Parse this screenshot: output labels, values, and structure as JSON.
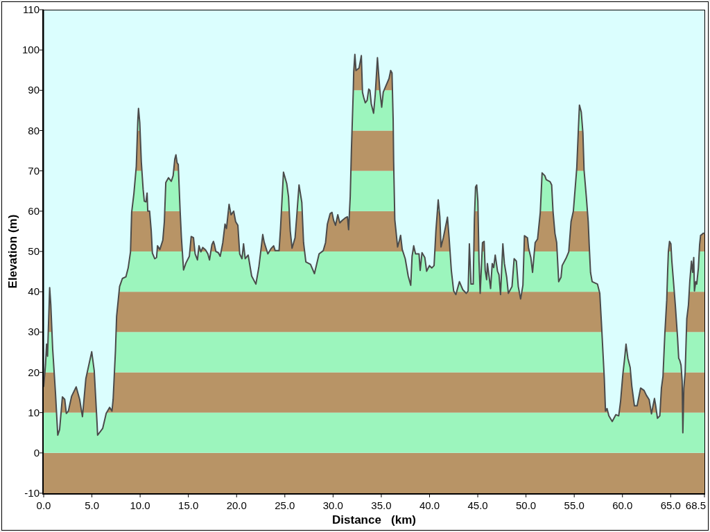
{
  "elevation_profile": {
    "chart_data": {
      "type": "area",
      "xlabel": "Distance   (km)",
      "ylabel": "Elevation (m)",
      "x": [
        0,
        0.19,
        0.3,
        0.4,
        0.5,
        0.62,
        0.74,
        0.93,
        1.22,
        1.46,
        1.65,
        1.94,
        2.18,
        2.35,
        2.56,
        2.9,
        3.37,
        3.73,
        4.02,
        4.37,
        4.98,
        5.24,
        5.53,
        5.59,
        6.12,
        6.48,
        6.84,
        7.08,
        7.2,
        7.44,
        7.56,
        7.87,
        8.16,
        8.52,
        8.76,
        9.0,
        9.12,
        9.35,
        9.6,
        9.76,
        9.83,
        9.96,
        10.12,
        10.31,
        10.43,
        10.6,
        10.72,
        10.79,
        10.98,
        11.15,
        11.27,
        11.51,
        11.7,
        11.8,
        12.04,
        12.35,
        12.51,
        12.66,
        12.94,
        13.23,
        13.42,
        13.59,
        13.71,
        13.83,
        13.95,
        14.14,
        14.28,
        14.5,
        14.74,
        15.1,
        15.29,
        15.53,
        15.7,
        15.94,
        16.1,
        16.3,
        16.49,
        16.78,
        17.02,
        17.19,
        17.44,
        17.6,
        17.7,
        17.85,
        18.1,
        18.3,
        18.57,
        18.8,
        18.95,
        19.22,
        19.42,
        19.7,
        19.9,
        20.13,
        20.32,
        20.56,
        20.72,
        20.89,
        21.2,
        21.56,
        22.0,
        22.3,
        22.71,
        22.86,
        23.24,
        23.6,
        23.84,
        24.0,
        24.4,
        24.55,
        24.86,
        25.2,
        25.38,
        25.56,
        25.75,
        26.06,
        26.23,
        26.47,
        26.76,
        26.94,
        27.18,
        27.66,
        28.07,
        28.55,
        28.98,
        29.22,
        29.41,
        29.7,
        29.89,
        30.06,
        30.25,
        30.49,
        30.7,
        30.94,
        31.25,
        31.49,
        31.61,
        31.78,
        31.9,
        32.09,
        32.14,
        32.26,
        32.38,
        32.69,
        32.93,
        33.05,
        33.17,
        33.34,
        33.53,
        33.7,
        33.82,
        33.96,
        34.2,
        34.37,
        34.6,
        34.85,
        35.04,
        35.2,
        35.44,
        35.8,
        35.97,
        36.11,
        36.23,
        36.28,
        36.4,
        36.52,
        36.69,
        36.88,
        37.0,
        37.17,
        37.48,
        37.79,
        38.05,
        38.19,
        38.36,
        38.55,
        38.91,
        39.03,
        39.22,
        39.51,
        39.7,
        39.99,
        40.23,
        40.47,
        40.66,
        40.9,
        41.07,
        41.19,
        41.43,
        41.86,
        42.03,
        42.26,
        42.5,
        42.73,
        43.1,
        43.45,
        43.81,
        44.0,
        44.13,
        44.3,
        44.53,
        44.65,
        44.77,
        44.89,
        45.01,
        45.13,
        45.25,
        45.49,
        45.66,
        45.77,
        45.92,
        46.0,
        46.15,
        46.33,
        46.5,
        46.65,
        46.81,
        47.05,
        47.2,
        47.36,
        47.6,
        47.76,
        48.0,
        48.17,
        48.55,
        48.77,
        49.0,
        49.2,
        49.44,
        49.68,
        49.84,
        50.15,
        50.27,
        50.5,
        50.68,
        50.95,
        51.2,
        51.48,
        51.67,
        51.95,
        52.1,
        52.5,
        52.66,
        52.8,
        53.0,
        53.18,
        53.39,
        53.63,
        53.75,
        54.19,
        54.43,
        54.67,
        54.91,
        55.26,
        55.43,
        55.54,
        55.73,
        55.9,
        56.02,
        56.26,
        56.45,
        56.55,
        56.69,
        56.86,
        57.41,
        57.65,
        57.81,
        57.97,
        58.12,
        58.24,
        58.4,
        58.59,
        58.94,
        59.32,
        59.61,
        59.8,
        60.04,
        60.2,
        60.37,
        60.56,
        60.8,
        60.97,
        61.24,
        61.52,
        61.88,
        62.24,
        62.48,
        62.77,
        63.01,
        63.15,
        63.32,
        63.44,
        63.63,
        63.87,
        64.04,
        64.2,
        64.4,
        64.59,
        64.69,
        64.76,
        64.88,
        65.02,
        65.12,
        65.24,
        65.48,
        65.71,
        65.83,
        65.95,
        66.07,
        66.19,
        66.26,
        66.36,
        66.5,
        66.67,
        66.84,
        66.98,
        67.15,
        67.27,
        67.39,
        67.46,
        67.6,
        67.7,
        67.87,
        68.0,
        68.1,
        68.23,
        68.35,
        68.5
      ],
      "series": [
        {
          "color": "#4a4a4a",
          "values": [
            16.5,
            21.9,
            27,
            24,
            32,
            41,
            36.7,
            25.9,
            15,
            4.4,
            5.8,
            13.9,
            13.3,
            9.8,
            10.4,
            14.1,
            16.4,
            13.3,
            9,
            18.4,
            25.1,
            20.4,
            7.5,
            4.4,
            6.1,
            9.8,
            11.3,
            10.4,
            13.3,
            25.3,
            33.9,
            41.3,
            43.3,
            43.7,
            45.9,
            49.9,
            59.7,
            64.3,
            71.1,
            82.6,
            85.5,
            82,
            72.3,
            65.4,
            62.5,
            62.3,
            64.5,
            60,
            60,
            55.1,
            49.6,
            48.2,
            48.5,
            51.4,
            50.5,
            52.8,
            57.4,
            67.1,
            68.3,
            67.4,
            68.8,
            72.9,
            74,
            72,
            71.6,
            60.3,
            53.4,
            45.4,
            47.1,
            48.8,
            53.7,
            53.4,
            49.4,
            47.9,
            51.4,
            49.9,
            51,
            50.4,
            49.4,
            47.9,
            51.7,
            52.5,
            51.7,
            50,
            49.7,
            48.8,
            52.2,
            56.8,
            55.7,
            61.7,
            59.1,
            60,
            57.4,
            56.5,
            49.4,
            48.2,
            51.9,
            48.2,
            49.1,
            43.9,
            41.9,
            46,
            54.2,
            52.3,
            49.4,
            50.8,
            51.4,
            50.2,
            50.2,
            55.7,
            69.7,
            66.8,
            63.6,
            55.1,
            50.8,
            53.4,
            58.6,
            66.5,
            62.2,
            52.2,
            47.4,
            46.8,
            44.5,
            49.4,
            50.2,
            52.2,
            56.8,
            59.4,
            59.7,
            57.7,
            56.5,
            59.1,
            57.1,
            57.7,
            58.3,
            58.6,
            55.4,
            63.7,
            75.1,
            89.5,
            94.6,
            98.9,
            94.9,
            95.5,
            98.6,
            89.5,
            88.3,
            86.9,
            87.5,
            90.3,
            90,
            86.6,
            84.3,
            88.9,
            98.1,
            90,
            85.8,
            89.5,
            90.9,
            92.9,
            94.9,
            94.3,
            82.6,
            72.3,
            57.9,
            55.1,
            51.1,
            52.8,
            54,
            50.5,
            48.2,
            43.9,
            41.6,
            48.8,
            51.4,
            49.4,
            49.4,
            45.3,
            49.7,
            48.5,
            45.1,
            46.5,
            45.9,
            46.5,
            55.1,
            62.8,
            58.6,
            51.1,
            53.4,
            58.5,
            53.4,
            45.3,
            40.2,
            39.3,
            42.5,
            40.5,
            39.6,
            40.2,
            51.9,
            41.9,
            41.9,
            58,
            66,
            66.5,
            62.5,
            47.6,
            39.6,
            52.2,
            52.5,
            45.3,
            43,
            47,
            44.2,
            40.8,
            47,
            46,
            49.1,
            45.1,
            44.2,
            39.3,
            51.9,
            47,
            43.6,
            39.6,
            41.3,
            48.2,
            47.6,
            41.3,
            38.2,
            41.6,
            53.9,
            53.4,
            50.8,
            48.5,
            44.8,
            52.2,
            53.1,
            59.7,
            69.5,
            68.8,
            67.8,
            67.3,
            66.5,
            60,
            54.5,
            52.2,
            42.5,
            43.6,
            46.5,
            48.5,
            49.9,
            57.4,
            60,
            70.6,
            80.3,
            86.3,
            84.6,
            79.4,
            70.2,
            63.4,
            57.4,
            51.7,
            44.8,
            42.5,
            41.9,
            39.6,
            32.7,
            25.3,
            18.4,
            10.4,
            11,
            9.2,
            7.8,
            9.5,
            9.2,
            12.7,
            19.5,
            22.9,
            27,
            23.5,
            21.2,
            16.6,
            11.7,
            11.7,
            16.1,
            15.5,
            14.3,
            13.2,
            9.7,
            11.5,
            13.5,
            11.8,
            8.6,
            9.2,
            16.1,
            19,
            29.9,
            37.9,
            45.4,
            49.9,
            52.5,
            51.9,
            47.6,
            44,
            36.7,
            28.7,
            23.5,
            22.9,
            21.8,
            17.8,
            5,
            16,
            20,
            33.3,
            36.7,
            42.5,
            47.6,
            44.8,
            48.5,
            40.2,
            42.5,
            41.9,
            45.9,
            51.7,
            54,
            54.2,
            54.5,
            54.5
          ]
        }
      ],
      "bands": [
        {
          "axis": "y",
          "from": -10,
          "to": 0,
          "color": "#b89466"
        }
      ],
      "xlim": [
        0,
        68.5
      ],
      "ylim": [
        -10,
        110
      ],
      "xticks": [
        {
          "value": 0,
          "label": "0.0"
        },
        {
          "value": 5,
          "label": "5.0"
        },
        {
          "value": 10,
          "label": "10.0"
        },
        {
          "value": 15,
          "label": "15.0"
        },
        {
          "value": 20,
          "label": "20.0"
        },
        {
          "value": 25,
          "label": "25.0"
        },
        {
          "value": 30,
          "label": "30.0"
        },
        {
          "value": 35,
          "label": "35.0"
        },
        {
          "value": 40,
          "label": "40.0"
        },
        {
          "value": 45,
          "label": "45.0"
        },
        {
          "value": 50,
          "label": "50.0"
        },
        {
          "value": 55,
          "label": "55.0"
        },
        {
          "value": 60,
          "label": "60.0"
        },
        {
          "value": 65,
          "label": "65.0"
        },
        {
          "value": 68.5,
          "label": "68.5"
        }
      ],
      "yticks": [
        -10,
        0,
        10,
        20,
        30,
        40,
        50,
        60,
        70,
        80,
        90,
        100,
        110
      ]
    }
  }
}
